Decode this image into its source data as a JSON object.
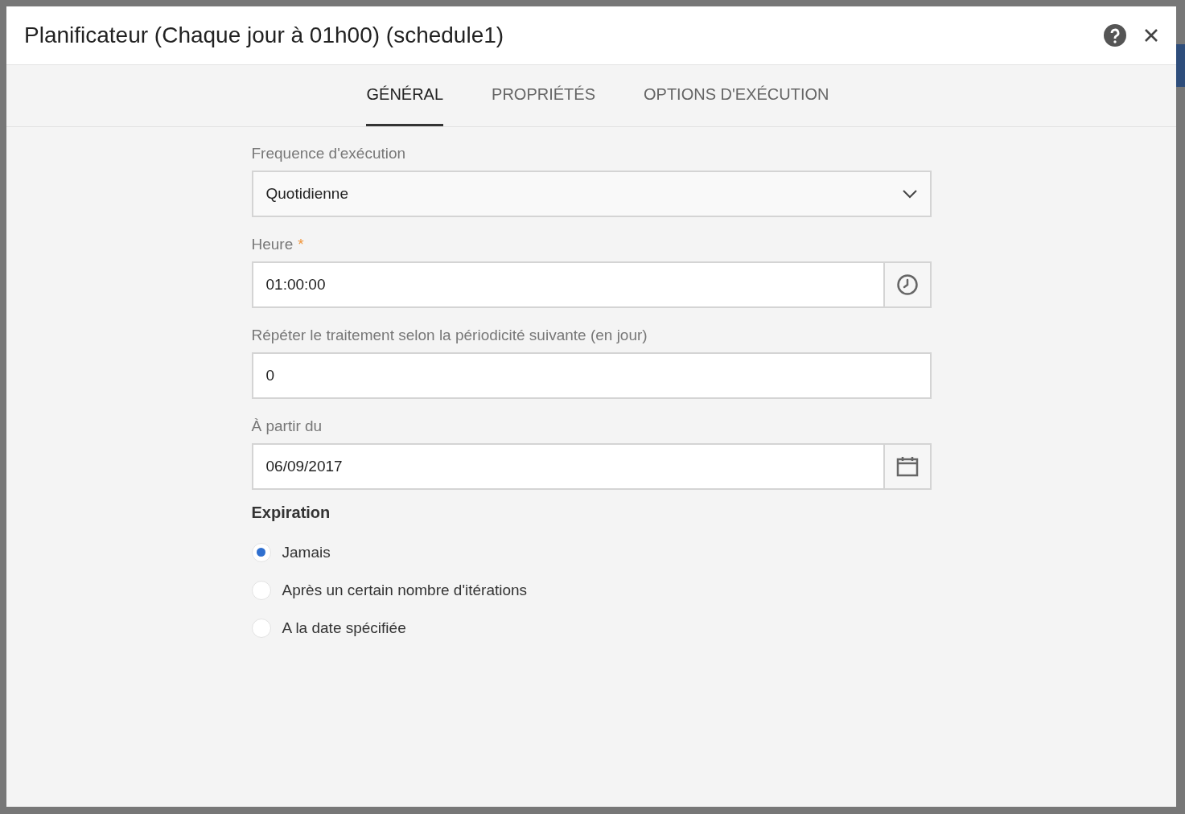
{
  "dialog": {
    "title": "Planificateur (Chaque jour à 01h00) (schedule1)"
  },
  "tabs": [
    {
      "label": "GÉNÉRAL",
      "selected": true
    },
    {
      "label": "PROPRIÉTÉS",
      "selected": false
    },
    {
      "label": "OPTIONS D'EXÉCUTION",
      "selected": false
    }
  ],
  "fields": [
    {
      "kind": "select",
      "label": "Frequence d'exécution",
      "value": "Quotidienne"
    },
    {
      "kind": "time",
      "label": "Heure",
      "required_mark": "*",
      "value": "01:00:00"
    },
    {
      "kind": "text",
      "label": "Répéter le traitement selon la périodicité suivante (en jour)",
      "value": "0"
    },
    {
      "kind": "date",
      "label": "À partir du",
      "value": "06/09/2017"
    }
  ],
  "expiration": {
    "title": "Expiration",
    "options": [
      {
        "label": "Jamais",
        "selected": true
      },
      {
        "label": "Après un certain nombre d'itérations",
        "selected": false
      },
      {
        "label": "A la date spécifiée",
        "selected": false
      }
    ]
  }
}
